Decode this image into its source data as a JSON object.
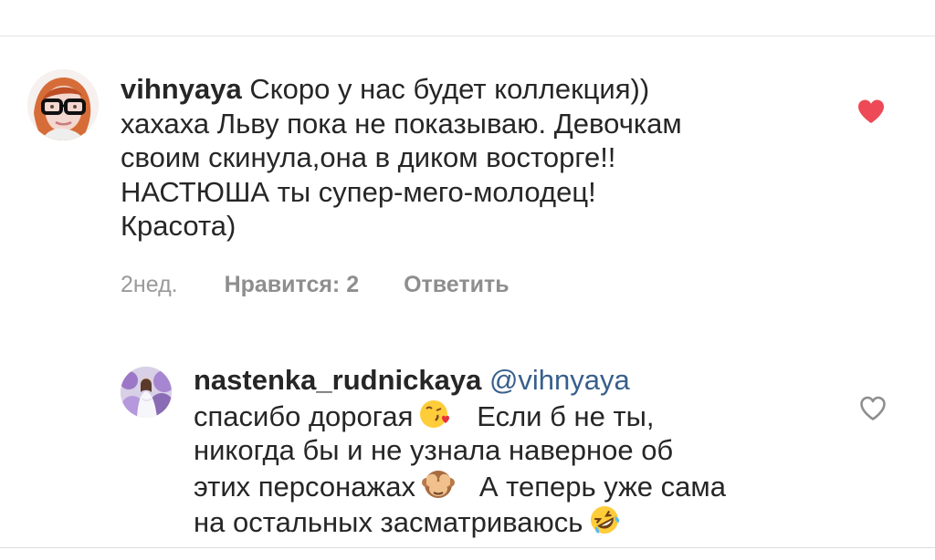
{
  "top_overflow": "· ·",
  "comments": [
    {
      "username": "vihnyaya",
      "lines": [
        "Скоро у нас будет коллекция))",
        "хахаха Льву пока не показываю. Девочкам",
        "своим скинула,она в диком восторге!!",
        "НАСТЮША ты супер-мего-молодец!",
        "Красота)"
      ],
      "time": "2нед.",
      "likes_label": "Нравится: 2",
      "reply_label": "Ответить",
      "liked": true,
      "avatar": "profile-photo-woman-glasses",
      "like_icon": "heart-filled-icon",
      "like_color": "#ed4956"
    },
    {
      "username": "nastenka_rudnickaya",
      "mention": "@vihnyaya",
      "line1_text": "спасибо дорогая",
      "line1_emoji": "face-blowing-kiss",
      "line1_text_after": "Если б не ты,",
      "line2": "никогда бы и не узнала наверное об",
      "line3_text": "этих персонажах",
      "line3_emoji": "see-no-evil-monkey",
      "line3_text_after": "А теперь уже сама",
      "line4_text": "на остальных засматриваюсь",
      "line4_emoji": "rolling-on-floor-laughing",
      "liked": false,
      "avatar": "profile-photo-woman-flowers",
      "like_icon": "heart-outline-icon"
    }
  ],
  "colors": {
    "text": "#262626",
    "meta": "#8e8e8e",
    "mention": "#385f8c",
    "like": "#ed4956"
  }
}
